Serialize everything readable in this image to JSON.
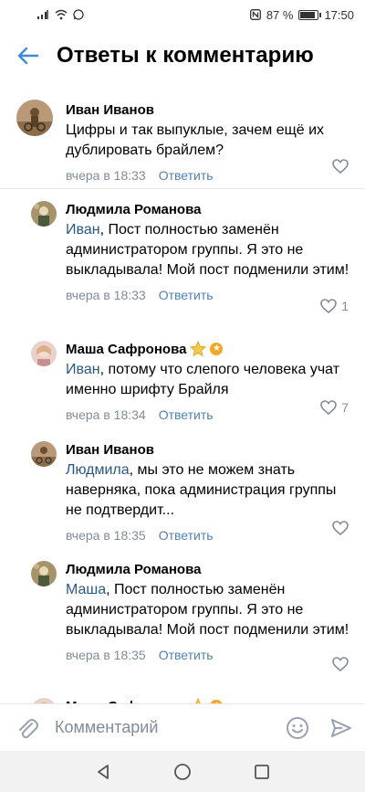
{
  "status_bar": {
    "battery_text": "87 %",
    "battery_level": 0.87,
    "time": "17:50"
  },
  "header": {
    "title": "Ответы к комментарию"
  },
  "comments": [
    {
      "author": "Иван Иванов",
      "text": "Цифры и так выпуклые, зачем ещё их дублировать брайлем?",
      "mention": "",
      "time": "вчера в 18:33",
      "reply_label": "Ответить",
      "likes": ""
    },
    {
      "author": "Людмила Романова",
      "mention": "Иван",
      "text": ", Пост полностью заменён администратором группы. Я это не выкладывала! Мой пост подменили этим!",
      "time": "вчера в 18:33",
      "reply_label": "Ответить",
      "likes": "1"
    },
    {
      "author": "Маша Сафронова",
      "mention": "Иван",
      "text": ", потому что слепого человека учат именно шрифту Брайля",
      "time": "вчера в 18:34",
      "reply_label": "Ответить",
      "likes": "7"
    },
    {
      "author": "Иван Иванов",
      "mention": "Людмила",
      "text": ", мы это не можем знать наверняка, пока администрация группы не подтвердит...",
      "time": "вчера в 18:35",
      "reply_label": "Ответить",
      "likes": ""
    },
    {
      "author": "Людмила Романова",
      "mention": "Маша",
      "text": ", Пост полностью заменён администратором группы. Я это не выкладывала! Мой пост подменили этим!",
      "time": "вчера в 18:35",
      "reply_label": "Ответить",
      "likes": ""
    },
    {
      "author": "Маша Сафронова"
    }
  ],
  "composer": {
    "placeholder": "Комментарий"
  },
  "colors": {
    "accent": "#5181b8",
    "mention": "#2a5885",
    "secondary_text": "#818c99",
    "divider": "#e7e8ec",
    "badge": "#f5a623"
  },
  "icons": {
    "back": "arrow-left-icon",
    "like": "heart-outline-icon",
    "attach": "paperclip-icon",
    "emoji": "smile-icon",
    "send": "send-arrow-icon",
    "star": "star-badge-icon",
    "nav_back": "triangle-back-icon",
    "nav_home": "circle-home-icon",
    "nav_recent": "square-recent-icon"
  }
}
